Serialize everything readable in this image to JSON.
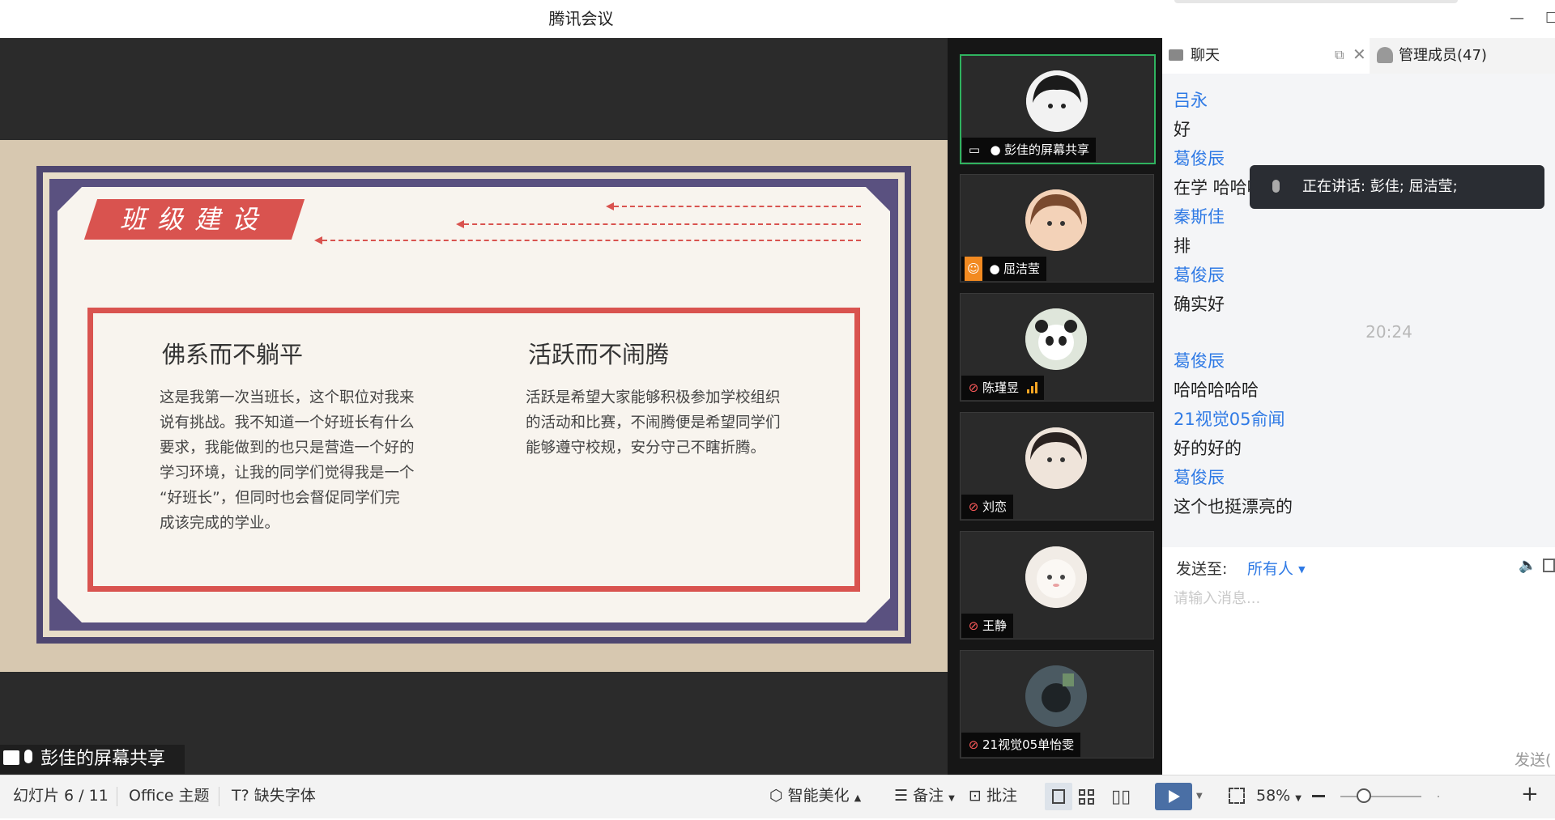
{
  "window": {
    "title": "腾讯会议",
    "minimize_glyph": "—",
    "maximize_glyph": "☐"
  },
  "slide": {
    "title": "班级建设",
    "left_heading": "佛系而不躺平",
    "left_body": [
      "这是我第一次当班长，这个职位对我来",
      "说有挑战。我不知道一个好班长有什么",
      "要求，我能做到的也只是营造一个好的",
      "学习环境，让我的同学们觉得我是一个",
      "“好班长”，但同时也会督促同学们完",
      "成该完成的学业。"
    ],
    "right_heading": "活跃而不闹腾",
    "right_body": [
      "活跃是希望大家能够积极参加学校组织",
      "的活动和比赛，不闹腾便是希望同学们",
      "能够遵守校规，安分守己不瞎折腾。"
    ],
    "accent_color": "#d9534f"
  },
  "share_label": "彭佳的屏幕共享",
  "participants": [
    {
      "name": "彭佳的屏幕共享",
      "mic": "on",
      "badge": "screen-share",
      "active": true,
      "avatar_color": "#e9e9e9"
    },
    {
      "name": "屈洁莹",
      "mic": "on",
      "badge": "person",
      "active": false,
      "avatar_color": "#f0c7a8"
    },
    {
      "name": "陈瑾昱",
      "mic": "muted",
      "badge": "signal",
      "active": false,
      "avatar_color": "#cfd6c8"
    },
    {
      "name": "刘恋",
      "mic": "muted",
      "badge": "",
      "active": false,
      "avatar_color": "#e9dcd2"
    },
    {
      "name": "王静",
      "mic": "muted",
      "badge": "",
      "active": false,
      "avatar_color": "#efe9e2"
    },
    {
      "name": "21视觉05单怡雯",
      "mic": "muted",
      "badge": "",
      "active": false,
      "avatar_color": "#3c4a52"
    }
  ],
  "chat": {
    "tab_chat": "聊天",
    "tab_members": "管理成员(47)",
    "messages": [
      {
        "sender": "吕永",
        "text": "好"
      },
      {
        "sender": "葛俊辰",
        "text": "在学 哈哈哈"
      },
      {
        "sender": "秦斯佳",
        "text": "排"
      },
      {
        "sender": "葛俊辰",
        "text": "确实好"
      }
    ],
    "time_separator": "20:24",
    "messages_after": [
      {
        "sender": "葛俊辰",
        "text": "哈哈哈哈哈"
      },
      {
        "sender": "21视觉05俞闻",
        "text": "好的好的"
      },
      {
        "sender": "葛俊辰",
        "text": "这个也挺漂亮的"
      }
    ],
    "speaking_label": "正在讲话: 彭佳; 屈洁莹;",
    "send_to_label": "发送至:",
    "send_to_value": "所有人",
    "input_placeholder": "请输入消息...",
    "send_button": "发送("
  },
  "statusbar": {
    "slide_counter": "幻灯片 6 / 11",
    "theme": "Office 主题",
    "missing_font": "缺失字体",
    "smart_beautify": "智能美化",
    "notes": "备注",
    "comments": "批注",
    "zoom": "58%",
    "zoom_level": 0.58
  },
  "colors": {
    "link_blue": "#2f7ae5",
    "active_green": "#2fb35f",
    "mute_red": "#ff5b5b",
    "signal_orange": "#f5a623"
  }
}
